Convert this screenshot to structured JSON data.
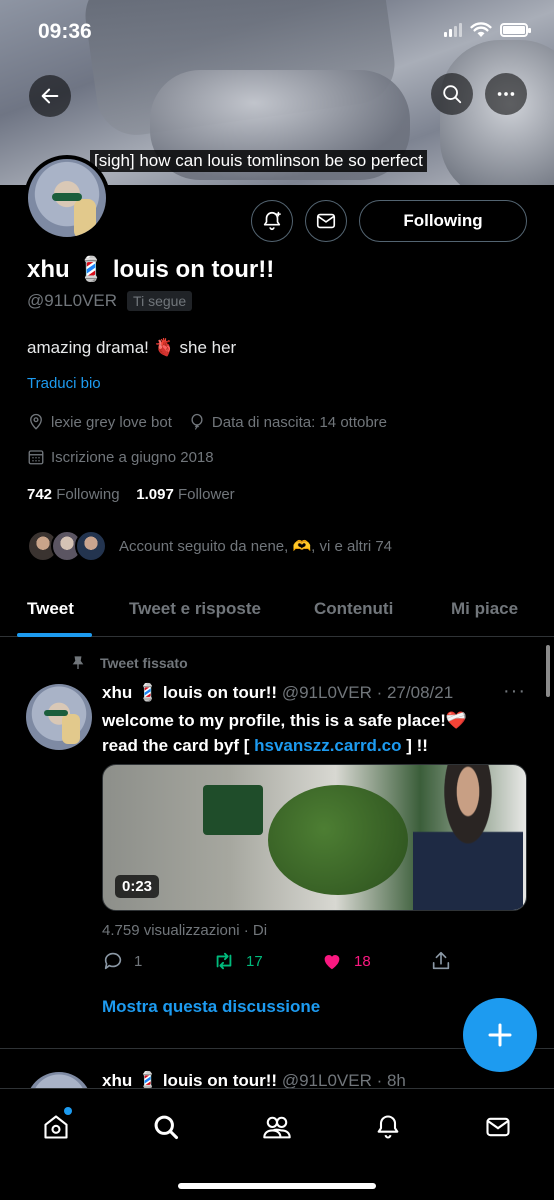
{
  "status_bar": {
    "time": "09:36"
  },
  "banner": {
    "caption": "[sigh] how can louis tomlinson be so perfect"
  },
  "profile": {
    "display_name": "xhu 💈 louis on tour!!",
    "handle": "@91L0VER",
    "follows_you_badge": "Ti segue",
    "bio": "amazing drama! 🫀 she her",
    "translate_label": "Traduci bio",
    "location": "lexie grey love bot",
    "birthday": "Data di nascita: 14 ottobre",
    "joined": "Iscrizione a giugno 2018",
    "following_count": "742",
    "following_label": "Following",
    "followers_count": "1.097",
    "followers_label": "Follower",
    "followed_by_text": "Account seguito da nene, 🫶, vi e altri 74",
    "following_button_label": "Following"
  },
  "tabs": [
    {
      "label": "Tweet",
      "active": true
    },
    {
      "label": "Tweet e risposte",
      "active": false
    },
    {
      "label": "Contenuti",
      "active": false
    },
    {
      "label": "Mi piace",
      "active": false
    }
  ],
  "pinned_tweet": {
    "pinned_label": "Tweet fissato",
    "author_name": "xhu 💈 louis on tour!!",
    "author_handle": "@91L0VER",
    "date": "· 27/08/21",
    "text_line1": "welcome to my profile, this is a safe place!❤️‍🩹",
    "text_prefix": "read the card byf [",
    "link": "hsvanszz.carrd.co",
    "text_suffix": "] !!",
    "video_duration": "0:23",
    "views": "4.759 visualizzazioni · Di",
    "replies": "1",
    "retweets": "17",
    "likes": "18",
    "show_thread": "Mostra questa discussione"
  },
  "next_tweet": {
    "author_name": "xhu 💈 louis on tour!!",
    "author_handle": "@91L0VER",
    "time": "· 8h"
  },
  "icons": {
    "back": "back-arrow-icon",
    "search": "search-icon",
    "more": "more-icon",
    "notify": "bell-plus-icon",
    "message": "mail-icon",
    "compose": "plus-icon"
  },
  "colors": {
    "accent": "#1d9bf0",
    "retweet": "#00ba7c",
    "like": "#f91880",
    "muted": "#71767b"
  }
}
